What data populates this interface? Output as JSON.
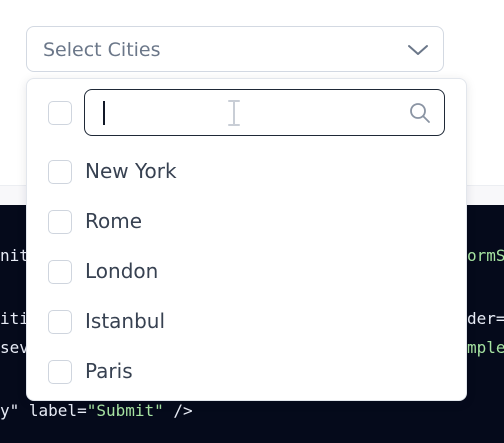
{
  "select": {
    "placeholder": "Select Cities",
    "expanded": true
  },
  "filter": {
    "value": "",
    "placeholder": ""
  },
  "options": [
    {
      "label": "New York",
      "checked": false
    },
    {
      "label": "Rome",
      "checked": false
    },
    {
      "label": "London",
      "checked": false
    },
    {
      "label": "Istanbul",
      "checked": false
    },
    {
      "label": "Paris",
      "checked": false
    }
  ],
  "code": {
    "line1_left": "nit",
    "line1_right": "ormS",
    "line2_left": "iti",
    "line2_right": "der=",
    "line3_left": "sev",
    "line3_right": "mple",
    "line4_a": "y\" label=",
    "line4_b": "\"Submit\"",
    "line4_c": " />"
  },
  "icons": {
    "chevron": "chevron-down-icon",
    "search": "search-icon",
    "cursor": "text-cursor-icon"
  },
  "colors": {
    "border": "#d3d9e2",
    "text": "#374151",
    "placeholder": "#6b7789",
    "code_bg": "#050a1b",
    "code_string": "#a6e3a1"
  }
}
